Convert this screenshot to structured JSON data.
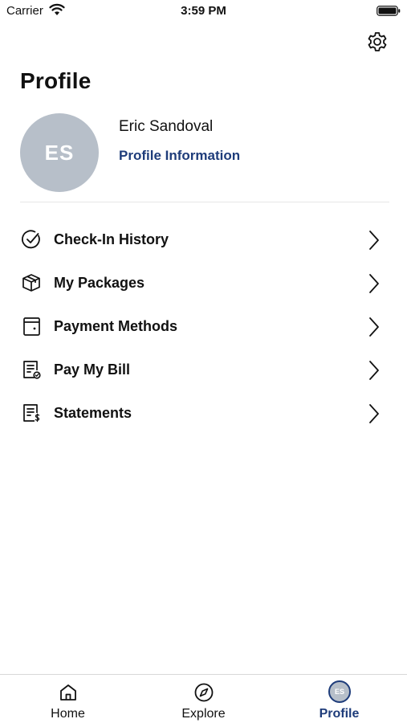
{
  "status_bar": {
    "carrier": "Carrier",
    "time": "3:59 PM"
  },
  "header": {
    "title": "Profile",
    "settings_icon": "gear-icon"
  },
  "user": {
    "initials": "ES",
    "name": "Eric Sandoval",
    "profile_link": "Profile Information",
    "avatar_color": "#b7bfc9"
  },
  "menu": [
    {
      "label": "Check-In History",
      "icon": "check-circle-icon"
    },
    {
      "label": "My Packages",
      "icon": "package-icon"
    },
    {
      "label": "Payment Methods",
      "icon": "wallet-icon"
    },
    {
      "label": "Pay My Bill",
      "icon": "bill-check-icon"
    },
    {
      "label": "Statements",
      "icon": "statement-dollar-icon"
    }
  ],
  "tabs": [
    {
      "label": "Home",
      "icon": "home-icon",
      "active": false
    },
    {
      "label": "Explore",
      "icon": "compass-icon",
      "active": false
    },
    {
      "label": "Profile",
      "icon": "avatar",
      "avatar_initials": "ES",
      "active": true
    }
  ],
  "colors": {
    "accent": "#1e3c7a",
    "text": "#111111",
    "divider": "#e6e6e6"
  }
}
